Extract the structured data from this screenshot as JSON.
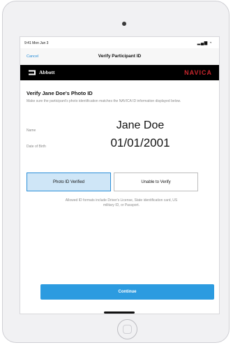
{
  "status_bar": {
    "time": "9:41 Mon Jun 3",
    "signal": "▂▄▆ ◔"
  },
  "nav": {
    "cancel_label": "Cancel",
    "title": "Verify Participant ID"
  },
  "brand": {
    "abbott": "Abbott",
    "navica": "NAVICA",
    "accent_color": "#c8262d"
  },
  "content": {
    "heading": "Verify Jane Doe's Photo ID",
    "instructions": "Make sure the participant's photo identification matches the NAVICA ID information displayed below.",
    "name_label": "Name",
    "name_value": "Jane Doe",
    "dob_label": "Date of Birth",
    "dob_value": "01/01/2001",
    "verified_button": "Photo ID Verified",
    "unable_button": "Unable to Verify",
    "formats_note": "Allowed ID formats include Driver's License, State identification card, US military ID, or Passport."
  },
  "footer": {
    "continue_label": "Continue",
    "primary_color": "#2c9be0"
  }
}
